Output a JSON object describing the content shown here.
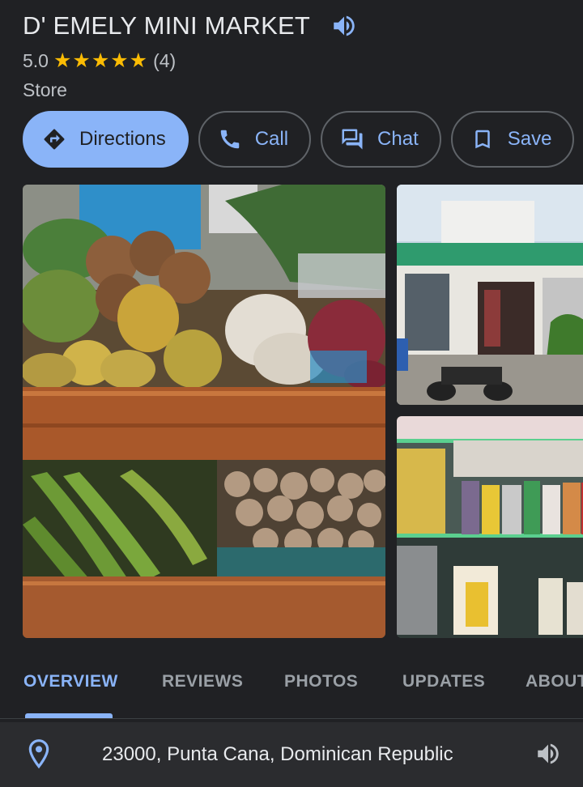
{
  "place": {
    "name": "D' EMELY MINI MARKET",
    "rating": "5.0",
    "stars": 5,
    "review_count": "(4)",
    "category": "Store"
  },
  "actions": [
    {
      "label": "Directions",
      "icon": "directions-icon"
    },
    {
      "label": "Call",
      "icon": "phone-icon"
    },
    {
      "label": "Chat",
      "icon": "chat-icon"
    },
    {
      "label": "Save",
      "icon": "bookmark-icon"
    }
  ],
  "photos": [
    {
      "subject": "produce-stand"
    },
    {
      "subject": "storefront"
    },
    {
      "subject": "vape-shelf"
    }
  ],
  "tabs": [
    "OVERVIEW",
    "REVIEWS",
    "PHOTOS",
    "UPDATES",
    "ABOUT"
  ],
  "active_tab": "OVERVIEW",
  "address": "23000, Punta Cana, Dominican Republic",
  "colors": {
    "background": "#202124",
    "accent": "#8ab4f8",
    "star": "#fbbc04",
    "text_primary": "#e8eaed",
    "text_secondary": "#bdc1c6"
  }
}
